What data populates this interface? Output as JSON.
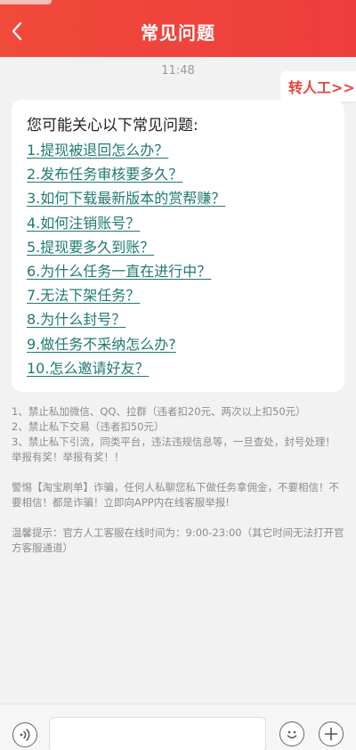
{
  "header": {
    "title": "常见问题",
    "back_icon": "chevron-left-icon",
    "bg_color": "#ef4138"
  },
  "chat": {
    "time": "11:48",
    "transfer_label": "转人工>>"
  },
  "faq": {
    "title": "您可能关心以下常见问题:",
    "items": [
      "1.提现被退回怎么办？",
      "2.发布任务审核要多久？",
      "3.如何下载最新版本的赏帮赚？",
      "4.如何注销账号？",
      "5.提现要多久到账？",
      "6.为什么任务一直在进行中？",
      "7.无法下架任务？",
      "8.为什么封号？",
      "9.做任务不采纳怎么办?",
      "10.怎么邀请好友？"
    ],
    "link_color": "#1f7a71"
  },
  "notice": {
    "rules": [
      "1、禁止私加微信、QQ、拉群（违者扣20元、两次以上扣50元）",
      "2、禁止私下交易（违者扣50元）",
      "3、禁止私下引流，同类平台，违法违规信息等，一旦查处，封号处理！",
      "举报有奖！举报有奖！！"
    ],
    "warning": "警惕【淘宝刷单】诈骗，任何人私聊您私下做任务拿佣金，不要相信！不要相信！都是诈骗！立即向APP内在线客服举报!",
    "hours": "温馨提示：官方人工客服在线时间为：9:00-23:00（其它时间无法打开官方客服通道）"
  },
  "input_bar": {
    "voice_icon": "voice-icon",
    "emoji_icon": "emoji-icon",
    "plus_icon": "plus-icon",
    "placeholder": ""
  }
}
